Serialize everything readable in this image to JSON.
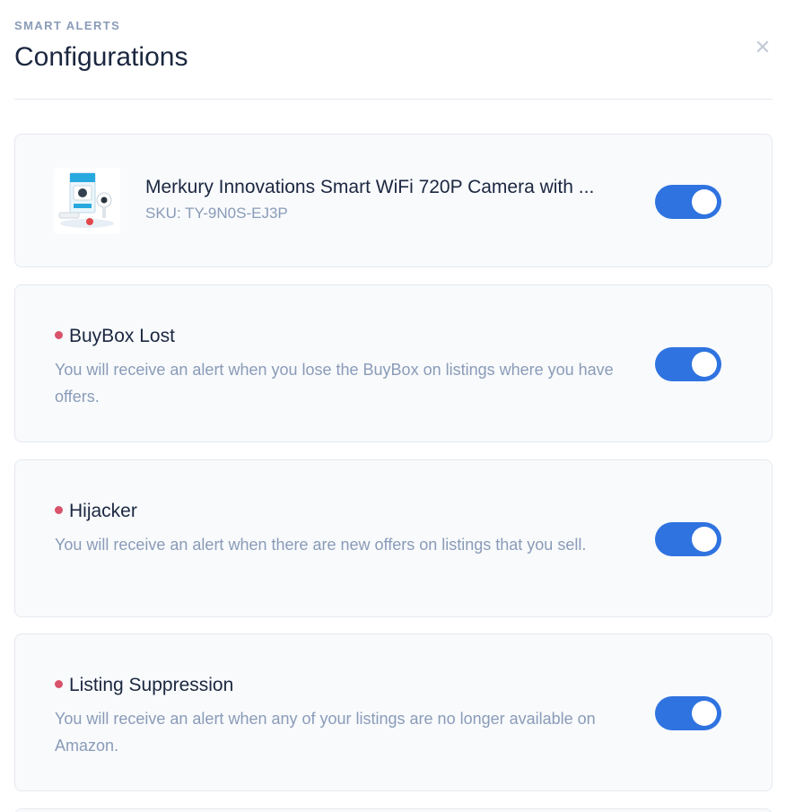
{
  "header": {
    "eyebrow": "SMART ALERTS",
    "title": "Configurations",
    "close_icon": "close-icon"
  },
  "product": {
    "name": "Merkury Innovations Smart WiFi 720P Camera with ...",
    "sku": "SKU: TY-9N0S-EJ3P",
    "enabled": true
  },
  "alerts": [
    {
      "title": "BuyBox Lost",
      "description": "You will receive an alert when you lose the BuyBox on listings where you have offers.",
      "enabled": true
    },
    {
      "title": "Hijacker",
      "description": "You will receive an alert when there are new offers on listings that you sell.",
      "enabled": true
    },
    {
      "title": "Listing Suppression",
      "description": "You will receive an alert when any of your listings are no longer available on Amazon.",
      "enabled": true
    }
  ],
  "colors": {
    "toggle_on": "#2f73e0",
    "alert_dot": "#d9536b",
    "muted_text": "#8a9bb8"
  }
}
